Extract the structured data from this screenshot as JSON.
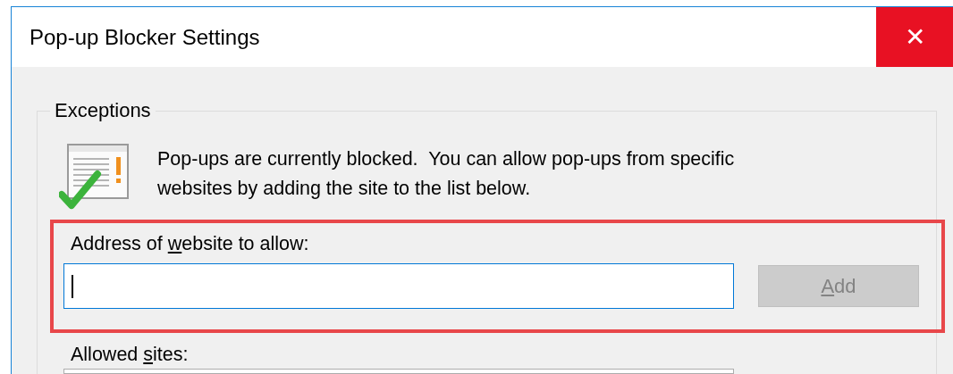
{
  "window": {
    "title": "Pop-up Blocker Settings",
    "close_button": "✕"
  },
  "exceptions": {
    "title": "Exceptions",
    "message_lines": [
      "Pop-ups are currently blocked.  You can allow pop-ups from specific",
      "websites by adding the site to the list below."
    ],
    "address_label": {
      "before": "Address of ",
      "access_key": "w",
      "after": "ebsite to allow:"
    },
    "address_field": {
      "focused": true
    },
    "add_button": {
      "access_key": "A",
      "after": "dd",
      "disabled": true
    },
    "allowed_sites_label": {
      "before": "Allowed ",
      "access_key": "s",
      "after": "ites:"
    }
  }
}
